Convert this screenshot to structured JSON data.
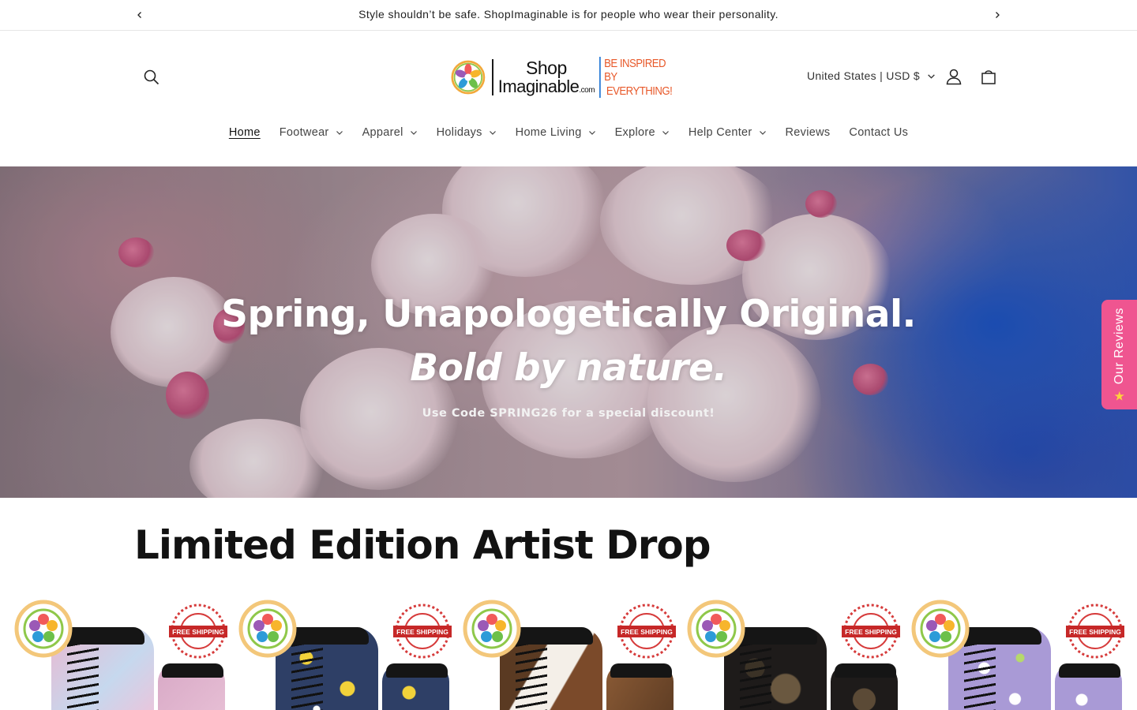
{
  "announcement": {
    "message": "Style shouldn’t be safe. ShopImaginable is for people who wear their personality.",
    "prev_icon": "chevron-left-icon",
    "next_icon": "chevron-right-icon"
  },
  "header": {
    "logo": {
      "line1": "Shop",
      "line2": "Imaginable",
      "line2_suffix": ".com",
      "tagline1": "BE INSPIRED BY",
      "tagline2": "EVERYTHING!"
    },
    "country_selector": "United States | USD $",
    "icons": [
      "search-icon",
      "account-icon",
      "cart-icon"
    ]
  },
  "nav": {
    "items": [
      {
        "label": "Home",
        "dropdown": false,
        "active": true
      },
      {
        "label": "Footwear",
        "dropdown": true
      },
      {
        "label": "Apparel",
        "dropdown": true
      },
      {
        "label": "Holidays",
        "dropdown": true
      },
      {
        "label": "Home Living",
        "dropdown": true
      },
      {
        "label": "Explore",
        "dropdown": true
      },
      {
        "label": "Help Center",
        "dropdown": true
      },
      {
        "label": "Reviews",
        "dropdown": false
      },
      {
        "label": "Contact Us",
        "dropdown": false
      }
    ]
  },
  "hero": {
    "title": "Spring, Unapologetically Original.",
    "subtitle": "Bold by nature.",
    "promo": "Use Code SPRING26 for a special discount!"
  },
  "reviews_tab": {
    "label": "Our Reviews",
    "icon": "star-icon"
  },
  "collection": {
    "title": "Limited Edition Artist Drop",
    "products": [
      {
        "pattern": "pink-pastel",
        "badge_text": "FREE SHIPPING"
      },
      {
        "pattern": "lemon-navy",
        "badge_text": "FREE SHIPPING"
      },
      {
        "pattern": "brown-white-cowhide",
        "badge_text": "FREE SHIPPING"
      },
      {
        "pattern": "dark-floral",
        "badge_text": "FREE SHIPPING"
      },
      {
        "pattern": "lavender-daisy",
        "badge_text": "FREE SHIPPING"
      }
    ]
  },
  "colors": {
    "accent_pink": "#ef5590",
    "logo_orange": "#e8592a",
    "text_dark": "#121212"
  }
}
